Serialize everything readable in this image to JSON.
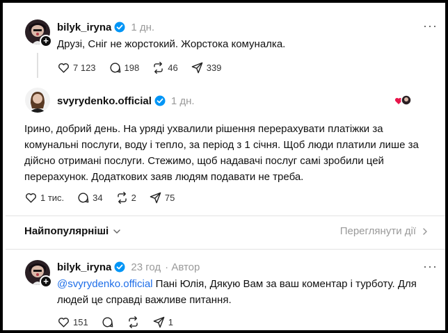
{
  "post1": {
    "username": "bilyk_iryna",
    "time": "1 дн.",
    "text": "Друзі, Сніг не жорстокий. Жорстока комуналка.",
    "likes": "7 123",
    "comments": "198",
    "reposts": "46",
    "shares": "339"
  },
  "post2": {
    "username": "svyrydenko.official",
    "time": "1 дн.",
    "text_lines": [
      "Ірино, добрий день. На уряді ухвалили рішення перерахувати платіжки за",
      "комунальні послуги, воду і тепло, за період з 1 січня. Щоб люди платили лише за",
      "дійсно отримані послуги. Стежимо, щоб надавачі послуг самі зробили цей",
      "перерахунок. Додаткових заяв людям подавати не треба."
    ],
    "likes": "1 тис.",
    "comments": "34",
    "reposts": "2",
    "shares": "75"
  },
  "sort": {
    "label": "Найпопулярніші",
    "view_activity": "Переглянути дії"
  },
  "reply": {
    "username": "bilyk_iryna",
    "time": "23 год",
    "author_tag": "· Автор",
    "mention": "@svyrydenko.official",
    "text_line1_rest": " Пані Юлія, Дякую Вам за ваш коментар і турботу. Для",
    "text_line2": "людей це справді важливе питання.",
    "likes": "151",
    "shares": "1"
  },
  "icons": {
    "more": "more-icon",
    "verified": "verified-badge-icon",
    "like": "heart-icon",
    "comment": "comment-icon",
    "repost": "repost-icon",
    "share": "share-icon",
    "follow": "plus-icon"
  },
  "colors": {
    "verified": "#0095f6",
    "mention": "#1e6ee8",
    "muted": "#999999"
  }
}
